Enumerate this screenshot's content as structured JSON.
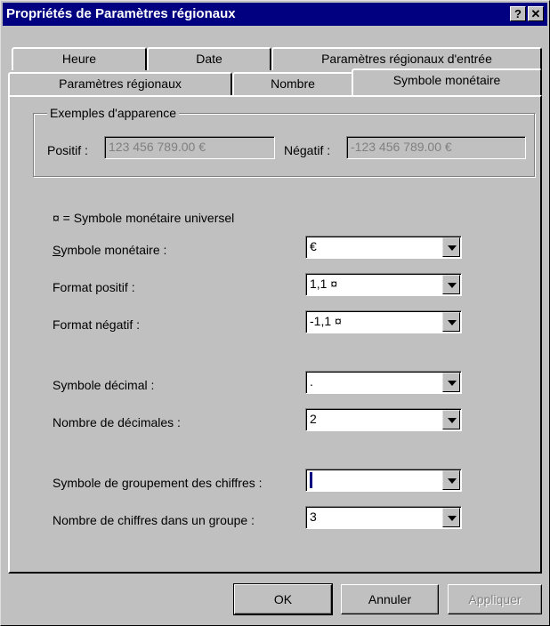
{
  "window": {
    "title": "Propriétés de Paramètres régionaux",
    "help_button": "?",
    "close_button": "✕"
  },
  "tabs_back": [
    "Heure",
    "Date",
    "Paramètres régionaux d'entrée"
  ],
  "tabs_front": [
    "Paramètres régionaux",
    "Nombre",
    "Symbole monétaire"
  ],
  "active_tab": "Symbole monétaire",
  "examples": {
    "legend": "Exemples d'apparence",
    "positive_label": "Positif :",
    "positive_value": "123 456 789.00 €",
    "negative_label": "Négatif :",
    "negative_value": "-123 456 789.00 €"
  },
  "universal_note": "¤ = Symbole monétaire universel",
  "fields": {
    "currency_symbol": {
      "label": "Symbole monétaire :",
      "value": "€"
    },
    "positive_format": {
      "label": "Format positif :",
      "value": "1,1 ¤"
    },
    "negative_format": {
      "label": "Format négatif :",
      "value": "-1,1 ¤"
    },
    "decimal_symbol": {
      "label": "Symbole décimal :",
      "value": "."
    },
    "decimal_count": {
      "label": "Nombre de décimales :",
      "value": "2"
    },
    "grouping_symbol": {
      "label": "Symbole de groupement des chiffres :",
      "value": ""
    },
    "digits_per_group": {
      "label": "Nombre de chiffres dans un groupe :",
      "value": "3"
    }
  },
  "buttons": {
    "ok": "OK",
    "cancel": "Annuler",
    "apply": "Appliquer",
    "apply_enabled": false
  }
}
